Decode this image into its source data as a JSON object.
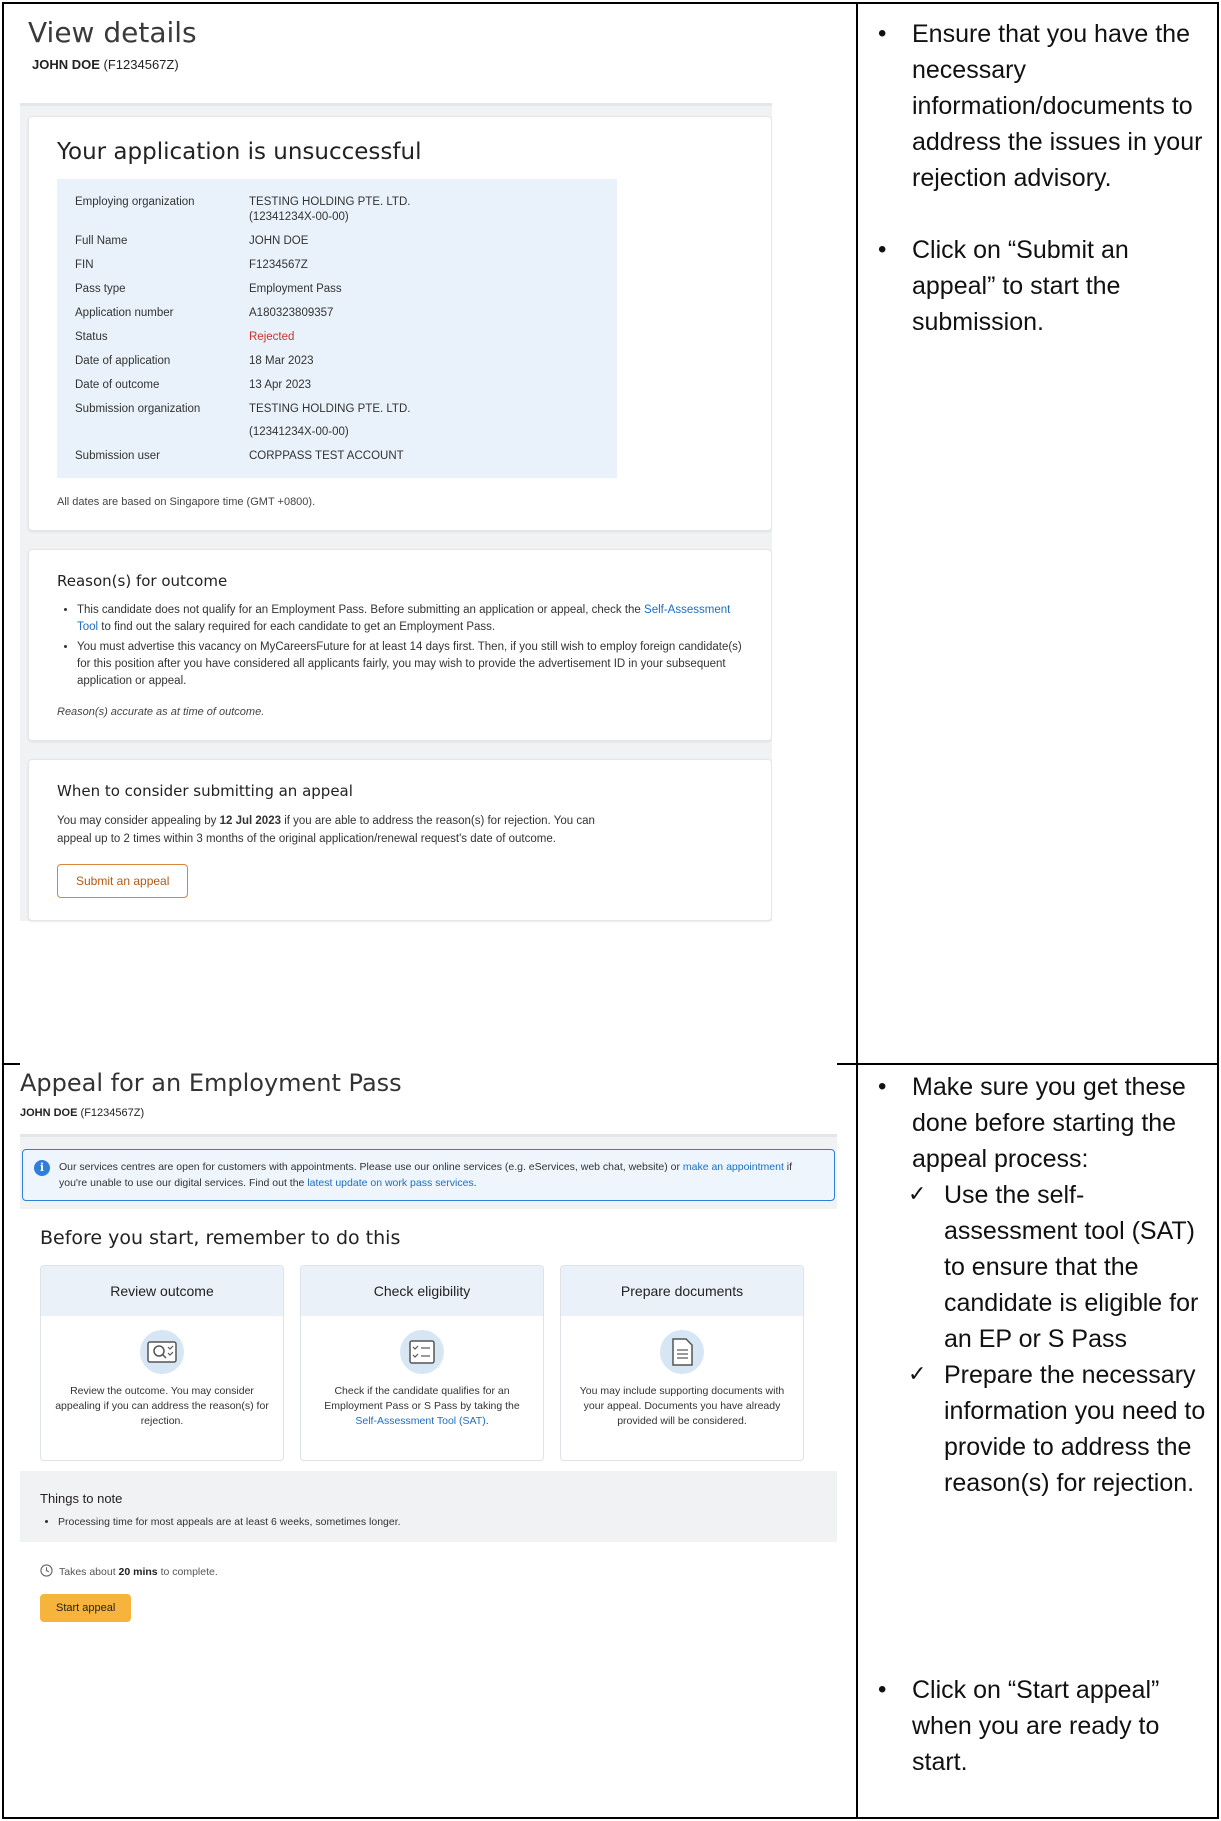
{
  "top_screenshot": {
    "title": "View details",
    "applicant_name": "JOHN DOE",
    "applicant_id": "(F1234567Z)",
    "status_card": {
      "heading": "Your application is unsuccessful",
      "rows": [
        {
          "label": "Employing organization",
          "value": "TESTING HOLDING PTE. LTD.",
          "value2": "(12341234X-00-00)"
        },
        {
          "label": "Full Name",
          "value": "JOHN DOE"
        },
        {
          "label": "FIN",
          "value": "F1234567Z"
        },
        {
          "label": "Pass type",
          "value": "Employment Pass"
        },
        {
          "label": "Application number",
          "value": "A180323809357"
        },
        {
          "label": "Status",
          "value": "Rejected"
        },
        {
          "label": "Date of application",
          "value": "18 Mar 2023"
        },
        {
          "label": "Date of outcome",
          "value": "13 Apr 2023"
        },
        {
          "label": "Submission organization",
          "value": "TESTING HOLDING PTE. LTD.",
          "value2": "(12341234X-00-00)"
        },
        {
          "label": "Submission user",
          "value": "CORPPASS TEST ACCOUNT"
        }
      ],
      "note": "All dates are based on Singapore time (GMT +0800)."
    },
    "reasons_card": {
      "heading": "Reason(s) for outcome",
      "reason1_before": "This candidate does not qualify for an Employment Pass. Before submitting an application or appeal, check the ",
      "reason1_link": "Self-Assessment Tool",
      "reason1_after": " to find out the salary required for each candidate to get an Employment Pass.",
      "reason2": "You must advertise this vacancy on MyCareersFuture for at least 14 days first. Then, if you still wish to employ foreign candidate(s) for this position after you have considered all applicants fairly, you may wish to provide the advertisement ID in your subsequent application or appeal.",
      "footnote": "Reason(s) accurate as at time of outcome."
    },
    "appeal_card": {
      "heading": "When to consider submitting an appeal",
      "text_before": "You may consider appealing by ",
      "deadline": "12 Jul 2023",
      "text_after": " if you are able to address the reason(s) for rejection. You can appeal up to 2 times within 3 months of the original application/renewal request's date of outcome.",
      "button": "Submit an appeal"
    }
  },
  "top_notes": {
    "bullet1": "Ensure that you have the necessary information/documents to address the issues in your rejection advisory.",
    "bullet2": "Click on “Submit an appeal” to start the submission."
  },
  "bottom_screenshot": {
    "title": "Appeal for an Employment Pass",
    "applicant_name": "JOHN DOE",
    "applicant_id": "(F1234567Z)",
    "notice_before": "Our services centres are open for customers with appointments. Please use our online services (e.g. eServices, web chat, website) or ",
    "notice_link1": "make an appointment",
    "notice_middle": " if you're unable to use our digital services. Find out the ",
    "notice_link2": "latest update on work pass services",
    "notice_after": ".",
    "card_heading": "Before you start, remember to do this",
    "tiles": [
      {
        "title": "Review outcome",
        "text": "Review the outcome. You may consider appealing if you can address the reason(s) for rejection.",
        "icon": "magnifier-document-icon"
      },
      {
        "title": "Check eligibility",
        "text_before": "Check if the candidate qualifies for an Employment Pass or S Pass by taking the ",
        "link": "Self-Assessment Tool (SAT)",
        "text_after": ".",
        "icon": "checklist-icon"
      },
      {
        "title": "Prepare documents",
        "text": "You may include supporting documents with your appeal. Documents you have already provided will be considered.",
        "icon": "document-icon"
      }
    ],
    "things_heading": "Things to note",
    "things_item": "Processing time for most appeals are at least 6 weeks, sometimes longer.",
    "takes_before": "Takes about ",
    "takes_bold": "20 mins",
    "takes_after": " to complete.",
    "start_button": "Start appeal"
  },
  "bottom_notes": {
    "bullet1": "Make sure you get these done before starting the appeal process:",
    "check1": "Use the self-assessment tool (SAT) to ensure that the candidate is eligible for an EP or S Pass",
    "check2": "Prepare the necessary information you need to provide to address the reason(s) for rejection.",
    "bullet2": "Click on “Start appeal” when you are ready to start."
  }
}
